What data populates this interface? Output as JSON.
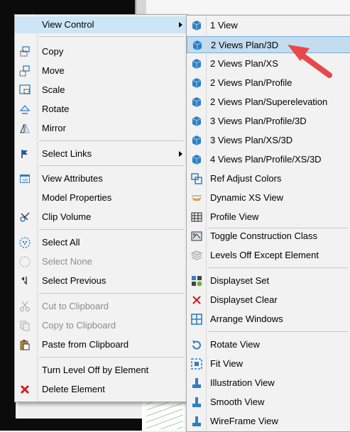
{
  "main_menu": {
    "items": [
      {
        "label": "View Control",
        "icon": "view-control-icon",
        "submenu": true,
        "highlighted": true
      },
      {
        "label": "Copy",
        "icon": "copy-element-icon"
      },
      {
        "label": "Move",
        "icon": "move-element-icon"
      },
      {
        "label": "Scale",
        "icon": "scale-element-icon"
      },
      {
        "label": "Rotate",
        "icon": "rotate-element-icon"
      },
      {
        "label": "Mirror",
        "icon": "mirror-element-icon"
      },
      {
        "label": "Select Links",
        "icon": "select-links-icon",
        "submenu": true
      },
      {
        "label": "View Attributes",
        "icon": "view-attributes-icon"
      },
      {
        "label": "Model Properties",
        "icon": ""
      },
      {
        "label": "Clip Volume",
        "icon": "clip-volume-icon"
      },
      {
        "label": "Select All",
        "icon": "select-all-icon"
      },
      {
        "label": "Select None",
        "icon": "select-none-icon",
        "disabled": true
      },
      {
        "label": "Select Previous",
        "icon": "select-previous-icon"
      },
      {
        "label": "Cut to Clipboard",
        "icon": "scissors-icon",
        "disabled": true
      },
      {
        "label": "Copy to Clipboard",
        "icon": "copy-clipboard-icon",
        "disabled": true
      },
      {
        "label": "Paste from Clipboard",
        "icon": "paste-clipboard-icon"
      },
      {
        "label": "Turn Level Off by Element",
        "icon": ""
      },
      {
        "label": "Delete Element",
        "icon": "delete-x-icon"
      }
    ]
  },
  "sub_menu": {
    "items": [
      {
        "label": "1 View",
        "icon": "cube-icon"
      },
      {
        "label": "2 Views Plan/3D",
        "icon": "cube-icon",
        "selected": true
      },
      {
        "label": "2 Views Plan/XS",
        "icon": "cube-icon"
      },
      {
        "label": "2 Views Plan/Profile",
        "icon": "cube-icon"
      },
      {
        "label": "2 Views Plan/Superelevation",
        "icon": "cube-icon"
      },
      {
        "label": "3 Views Plan/Profile/3D",
        "icon": "cube-icon"
      },
      {
        "label": "3 Views Plan/XS/3D",
        "icon": "cube-icon"
      },
      {
        "label": "4 Views Plan/Profile/XS/3D",
        "icon": "cube-icon"
      },
      {
        "label": "Ref Adjust Colors",
        "icon": "ref-adjust-colors-icon"
      },
      {
        "label": "Dynamic XS View",
        "icon": "dynamic-xs-icon"
      },
      {
        "label": "Profile View",
        "icon": "profile-view-icon"
      },
      {
        "label": "Toggle Construction Class",
        "icon": "construction-class-icon"
      },
      {
        "label": "Levels Off Except Element",
        "icon": "levels-off-icon"
      },
      {
        "label": "Displayset Set",
        "icon": "displayset-set-icon"
      },
      {
        "label": "Displayset Clear",
        "icon": "displayset-clear-icon"
      },
      {
        "label": "Arrange Windows",
        "icon": "arrange-windows-icon"
      },
      {
        "label": "Rotate View",
        "icon": "rotate-view-icon"
      },
      {
        "label": "Fit View",
        "icon": "fit-view-icon"
      },
      {
        "label": "Illustration View",
        "icon": "illustration-view-icon"
      },
      {
        "label": "Smooth View",
        "icon": "smooth-view-icon"
      },
      {
        "label": "WireFrame View",
        "icon": "wireframe-view-icon"
      }
    ]
  },
  "colors": {
    "highlight": "#cde6f7",
    "selected_border": "#7ab0d8",
    "annotation_arrow": "#e8474a",
    "delete_x": "#d42020",
    "cube": "#2f7fc4"
  }
}
